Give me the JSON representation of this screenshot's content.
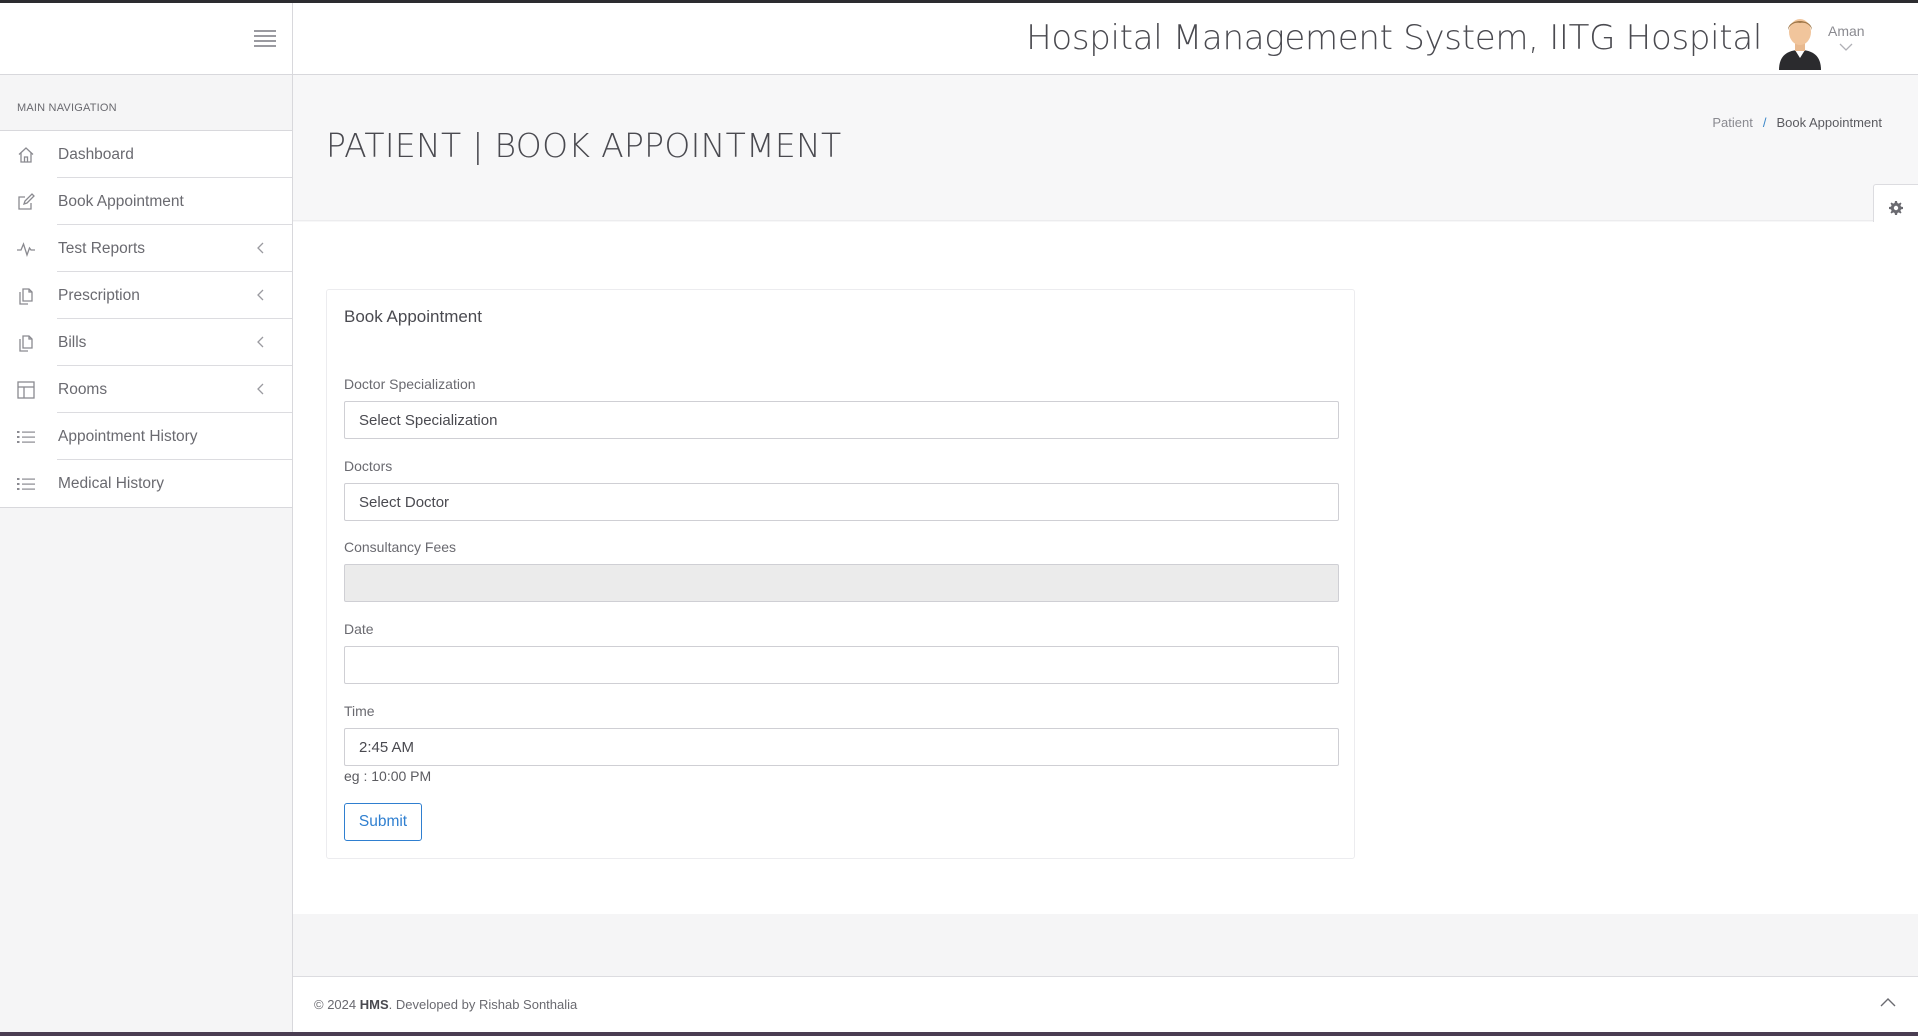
{
  "header": {
    "app_title": "Hospital Management System, IITG Hospital",
    "user_name": "Aman"
  },
  "sidebar": {
    "nav_title": "MAIN NAVIGATION",
    "items": [
      {
        "label": "Dashboard",
        "icon": "home-icon",
        "has_submenu": false
      },
      {
        "label": "Book Appointment",
        "icon": "edit-icon",
        "has_submenu": false
      },
      {
        "label": "Test Reports",
        "icon": "pulse-icon",
        "has_submenu": true
      },
      {
        "label": "Prescription",
        "icon": "files-icon",
        "has_submenu": true
      },
      {
        "label": "Bills",
        "icon": "files-icon",
        "has_submenu": true
      },
      {
        "label": "Rooms",
        "icon": "layout-icon",
        "has_submenu": true
      },
      {
        "label": "Appointment History",
        "icon": "list-icon",
        "has_submenu": false
      },
      {
        "label": "Medical History",
        "icon": "list-icon",
        "has_submenu": false
      }
    ]
  },
  "page": {
    "title": "PATIENT | BOOK APPOINTMENT",
    "breadcrumb": [
      "Patient",
      "Book Appointment"
    ]
  },
  "form": {
    "panel_title": "Book Appointment",
    "specialization": {
      "label": "Doctor Specialization",
      "value": "Select Specialization"
    },
    "doctor": {
      "label": "Doctors",
      "value": "Select Doctor"
    },
    "fees": {
      "label": "Consultancy Fees",
      "value": ""
    },
    "date": {
      "label": "Date",
      "value": ""
    },
    "time": {
      "label": "Time",
      "value": "2:45 AM",
      "hint": "eg : 10:00 PM"
    },
    "submit_label": "Submit"
  },
  "footer": {
    "year_text": "© 2024",
    "brand": "HMS",
    "developer_text": ". Developed by Rishab Sonthalia"
  },
  "colors": {
    "accent": "#2f7fd0",
    "breadcrumb_separator": "#3a86c8",
    "readonly_field": "#ebebeb"
  }
}
